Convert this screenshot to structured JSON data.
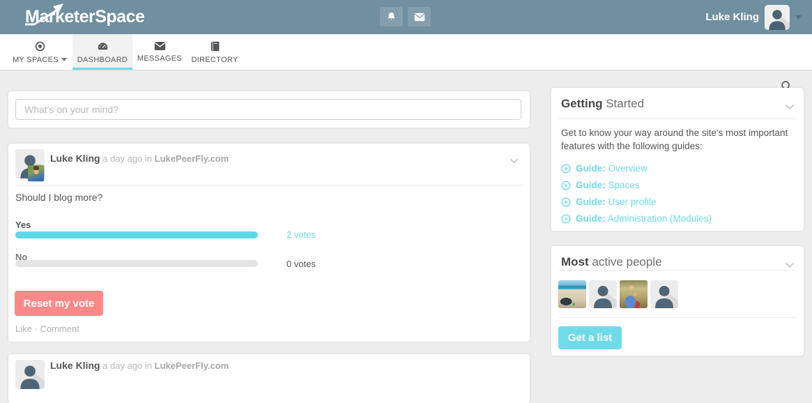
{
  "topbar": {
    "logo": "MarketerSpace",
    "user_name": "Luke Kling",
    "icons": {
      "bell": "bell-icon",
      "mail": "envelope-icon",
      "user_caret": "caret-down-icon"
    }
  },
  "nav": {
    "tabs": [
      {
        "label": "MY SPACES",
        "icon": "dot-circle-icon",
        "has_caret": true,
        "active": false
      },
      {
        "label": "DASHBOARD",
        "icon": "gauge-icon",
        "active": true
      },
      {
        "label": "MESSAGES",
        "icon": "envelope-icon",
        "active": false
      },
      {
        "label": "DIRECTORY",
        "icon": "book-icon",
        "active": false
      }
    ],
    "search_icon": "search-icon"
  },
  "composer": {
    "placeholder": "What's on your mind?"
  },
  "post": {
    "author": "Luke Kling",
    "meta": "a day ago in",
    "space": "LukePeerFly.com",
    "question": "Should I blog more?",
    "poll": {
      "options": [
        {
          "label": "Yes",
          "votes": 2,
          "votes_label": "2 votes",
          "fill": 1
        },
        {
          "label": "No",
          "votes": 0,
          "votes_label": "0 votes",
          "fill": 0
        }
      ]
    },
    "reset_button": "Reset my vote",
    "like_label": "Like",
    "separator": "·",
    "comment_label": "Comment"
  },
  "post2": {
    "author": "Luke Kling",
    "meta": "a day ago in",
    "space": "LukePeerFly.com"
  },
  "sidebar": {
    "getting_started": {
      "title_bold": "Getting",
      "title_rest": " Started",
      "intro": "Get to know your way around the site's most important features with the following guides:",
      "guides": [
        {
          "bold": "Guide:",
          "label": " Overview"
        },
        {
          "bold": "Guide:",
          "label": " Spaces"
        },
        {
          "bold": "Guide:",
          "label": " User profile"
        },
        {
          "bold": "Guide:",
          "label": " Administration (Modules)"
        }
      ]
    },
    "most_active": {
      "title_bold": "Most",
      "title_rest": " active people",
      "avatars": [
        {
          "type": "photo-beach"
        },
        {
          "type": "placeholder"
        },
        {
          "type": "photo-couple"
        },
        {
          "type": "placeholder"
        }
      ],
      "button_label": "Get a list"
    }
  },
  "colors": {
    "header_bg": "#708fa0",
    "accent": "#6fdbe8",
    "poll_fill": "#5cd9e8",
    "danger": "#ff8989",
    "page_bg": "#ededed"
  }
}
